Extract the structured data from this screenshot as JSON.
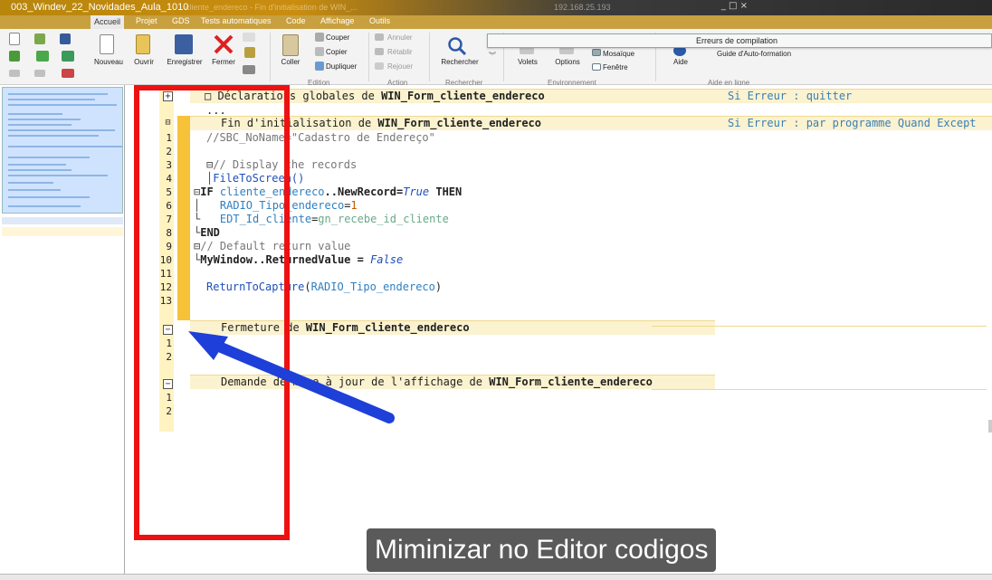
{
  "window": {
    "title": "003_Windev_22_Novidades_Aula_1010",
    "subtitle": "cliente_endereco - Fin d'initialisation de WIN_...",
    "ip": "192.168.25.193",
    "controls": "_ □ ×"
  },
  "menu": {
    "tabs": [
      "Accueil",
      "Projet",
      "GDS",
      "Tests automatiques",
      "Code",
      "Affichage",
      "Outils"
    ],
    "active": "Accueil"
  },
  "ribbon": {
    "nouveau": "Nouveau",
    "ouvrir": "Ouvrir",
    "enregistrer": "Enregistrer",
    "fermer": "Fermer",
    "coller": "Coller",
    "couper": "Couper",
    "copier": "Copier",
    "dupliquer": "Dupliquer",
    "annuler": "Annuler",
    "retablir": "Rétablir",
    "rejouer": "Rejouer",
    "rechercher": "Rechercher",
    "volets": "Volets",
    "options": "Options",
    "mosaique": "Mosaïque",
    "fenetre": "Fenêtre",
    "aide": "Aide",
    "guide": "Guide d'Auto-formation",
    "group_edition": "Edition",
    "group_action": "Action",
    "group_rechercher": "Rechercher",
    "group_environnement": "Environnement",
    "group_aide": "Aide en ligne"
  },
  "errors_panel": {
    "title": "Erreurs de compilation"
  },
  "editor": {
    "sections": [
      {
        "prefix": "Déclarations globales de ",
        "window": "WIN_Form_cliente_endereco",
        "onerror": "Si Erreur : quitter",
        "dots": "..."
      },
      {
        "prefix": "Fin d'initialisation de ",
        "window": "WIN_Form_cliente_endereco",
        "onerror": "Si Erreur : par programme Quand Except"
      },
      {
        "prefix": "Fermeture de ",
        "window": "WIN_Form_cliente_endereco"
      },
      {
        "prefix": "Demande de mise à jour de l'affichage de ",
        "window": "WIN_Form_cliente_endereco"
      }
    ],
    "code_lines": [
      {
        "n": "1",
        "text": "//SBC_NoName=\"Cadastro de Endereço\""
      },
      {
        "n": "2",
        "text": ""
      },
      {
        "n": "3",
        "text": "// Display the records"
      },
      {
        "n": "4",
        "text": "FileToScreen()"
      },
      {
        "n": "5",
        "text": "IF cliente_endereco..NewRecord=True THEN"
      },
      {
        "n": "6",
        "text": "RADIO_Tipo_endereco=1"
      },
      {
        "n": "7",
        "text": "EDT_Id_cliente=gn_recebe_id_cliente"
      },
      {
        "n": "8",
        "text": "END"
      },
      {
        "n": "9",
        "text": "// Default return value"
      },
      {
        "n": "10",
        "text": "MyWindow..ReturnedValue = False"
      },
      {
        "n": "11",
        "text": ""
      },
      {
        "n": "12",
        "text": "ReturnToCapture(RADIO_Tipo_endereco)"
      },
      {
        "n": "13",
        "text": ""
      }
    ],
    "fermeture_lines": [
      "1",
      "2"
    ],
    "demande_lines": [
      "1",
      "2"
    ]
  },
  "caption": "Miminizar no Editor codigos",
  "colors": {
    "highlight_red": "#e11111",
    "arrow_blue": "#1e3fd8",
    "section_yellow": "#f6c23a"
  }
}
